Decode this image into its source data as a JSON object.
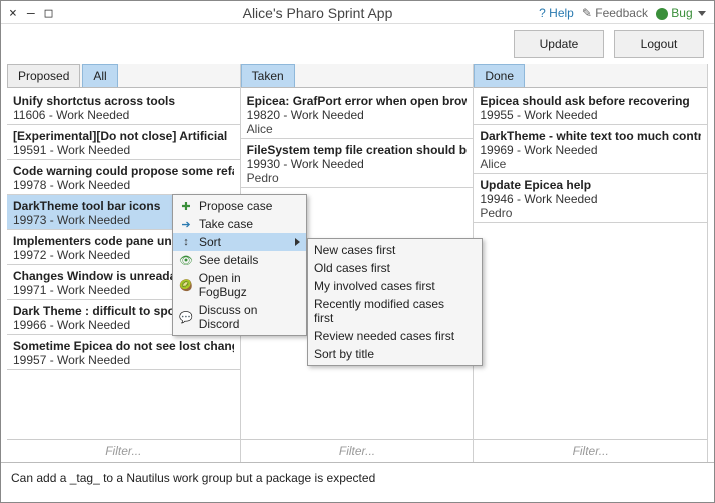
{
  "window": {
    "title": "Alice's Pharo Sprint App",
    "controls": {
      "close": "×",
      "minimize": "–",
      "maximize": "□"
    }
  },
  "titlebar_links": {
    "help": "Help",
    "feedback": "Feedback",
    "bug": "Bug"
  },
  "toolbar": {
    "update": "Update",
    "logout": "Logout"
  },
  "columns": {
    "proposed": {
      "tabs": [
        "Proposed",
        "All"
      ],
      "active_tab": 1,
      "items": [
        {
          "title": "Unify shortctus across tools",
          "id": "11606",
          "status": "Work Needed"
        },
        {
          "title": " [Experimental][Do not close] Artificial",
          "id": "19591",
          "status": "Work Needed"
        },
        {
          "title": "Code warning could propose some refa",
          "id": "19978",
          "status": "Work Needed"
        },
        {
          "title": "DarkTheme tool bar icons",
          "id": "19973",
          "status": "Work Needed",
          "selected": true
        },
        {
          "title": "Implementers code pane und",
          "id": "19972",
          "status": "Work Needed"
        },
        {
          "title": "Changes Window is unreadab",
          "id": "19971",
          "status": "Work Needed"
        },
        {
          "title": "Dark Theme : difficult to spot scrollbar",
          "id": "19966",
          "status": "Work Needed"
        },
        {
          "title": "Sometime Epicea do not see lost chang",
          "id": "19957",
          "status": "Work Needed"
        }
      ],
      "filter_placeholder": "Filter..."
    },
    "taken": {
      "tabs": [
        "Taken"
      ],
      "active_tab": 0,
      "items": [
        {
          "title": "Epicea: GrafPort error when open browse",
          "id": "19820",
          "status": "Work Needed",
          "assignee": "Alice"
        },
        {
          "title": "FileSystem temp file creation should be r",
          "id": "19930",
          "status": "Work Needed",
          "assignee": "Pedro"
        }
      ],
      "filter_placeholder": "Filter..."
    },
    "done": {
      "tabs": [
        "Done"
      ],
      "active_tab": 0,
      "items": [
        {
          "title": "Epicea should ask before recovering",
          "id": "19955",
          "status": "Work Needed"
        },
        {
          "title": "DarkTheme - white text too much contras",
          "id": "19969",
          "status": "Work Needed",
          "assignee": "Alice"
        },
        {
          "title": "Update Epicea help",
          "id": "19946",
          "status": "Work Needed",
          "assignee": "Pedro"
        }
      ],
      "filter_placeholder": "Filter..."
    }
  },
  "context_menu": {
    "items": [
      {
        "icon": "plus",
        "label": "Propose case"
      },
      {
        "icon": "arrow",
        "label": "Take case"
      },
      {
        "icon": "sort",
        "label": "Sort",
        "submenu": true,
        "highlight": true
      },
      {
        "icon": "eye",
        "label": "See details"
      },
      {
        "icon": "kiwi",
        "label": "Open in FogBugz"
      },
      {
        "icon": "chat",
        "label": "Discuss on Discord"
      }
    ],
    "sort_submenu": [
      "New cases first",
      "Old cases first",
      "My involved cases first",
      "Recently modified cases first",
      "Review needed cases first",
      "Sort by title"
    ]
  },
  "status": "Can add a _tag_ to a Nautilus work group but a package is expected"
}
